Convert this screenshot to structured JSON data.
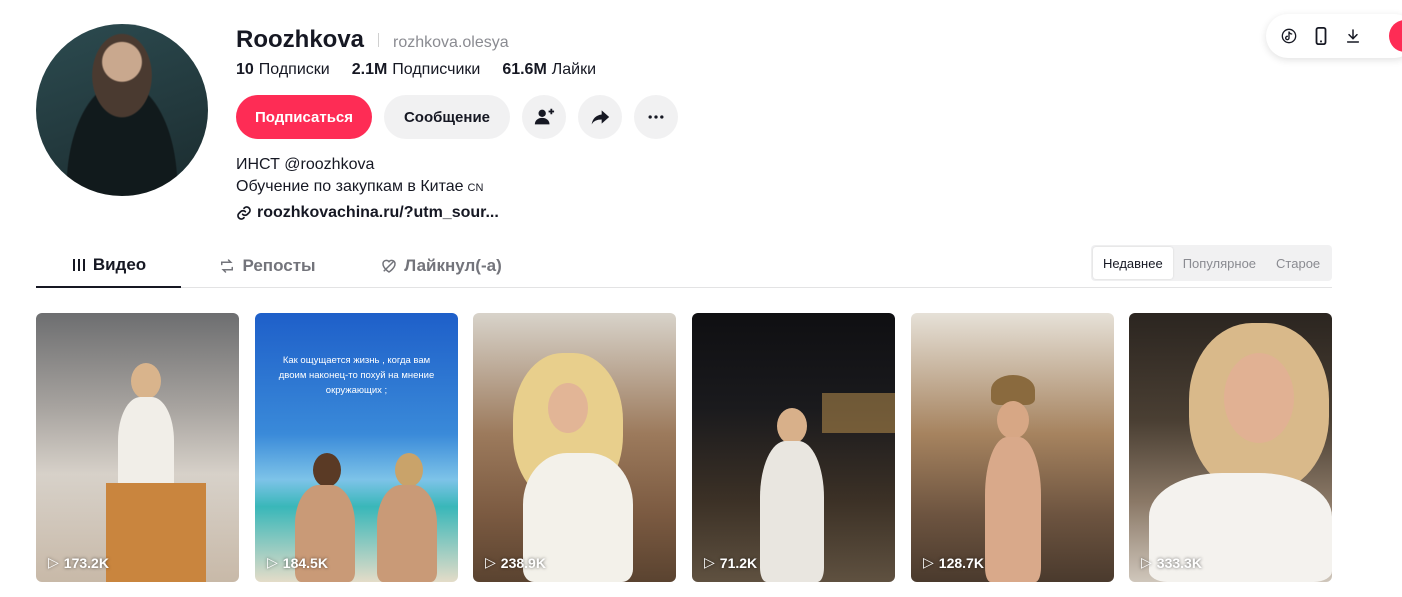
{
  "profile": {
    "display_name": "Roozhkova",
    "username": "rozhkova.olesya",
    "stats": [
      {
        "value": "10",
        "label": "Подписки"
      },
      {
        "value": "2.1M",
        "label": "Подписчики"
      },
      {
        "value": "61.6M",
        "label": "Лайки"
      }
    ],
    "bio_line1": "ИНСТ @roozhkova",
    "bio_line2": "Обучение по закупкам в Китае",
    "bio_flag": "CN",
    "link": "roozhkovachina.ru/?utm_sour..."
  },
  "actions": {
    "follow_label": "Подписаться",
    "message_label": "Сообщение"
  },
  "tabs": [
    {
      "label": "Видео",
      "icon": "grid-icon"
    },
    {
      "label": "Репосты",
      "icon": "repost-icon"
    },
    {
      "label": "Лайкнул(-а)",
      "icon": "heart-hidden-icon"
    }
  ],
  "sort": [
    {
      "label": "Недавнее"
    },
    {
      "label": "Популярное"
    },
    {
      "label": "Старое"
    }
  ],
  "videos": [
    {
      "views": "173.2K"
    },
    {
      "views": "184.5K",
      "overlay": "Как ощущается жизнь , когда вам двоим наконец-то похуй на мнение окружающих ;"
    },
    {
      "views": "238.9K"
    },
    {
      "views": "71.2K"
    },
    {
      "views": "128.7K"
    },
    {
      "views": "333.3K"
    }
  ],
  "colors": {
    "accent": "#fe2c55",
    "text": "#161823",
    "muted": "#8a8b91",
    "button_bg": "#f1f1f2"
  }
}
